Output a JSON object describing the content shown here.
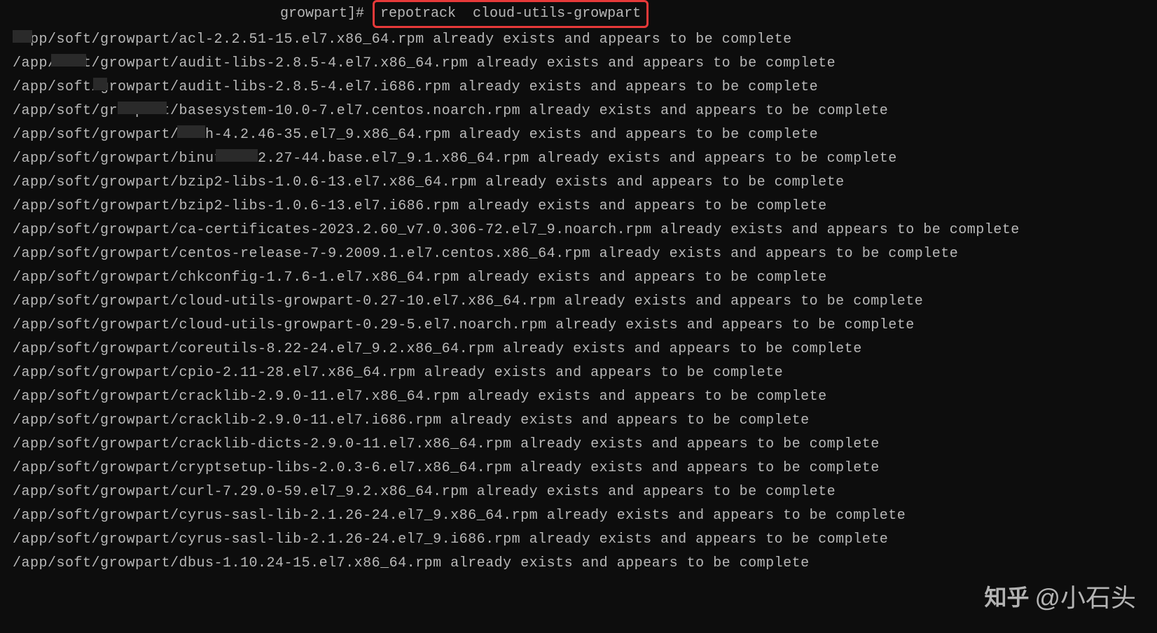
{
  "prompt": {
    "path_suffix": " growpart]# ",
    "command": "repotrack  cloud-utils-growpart"
  },
  "output_lines": [
    "/app/soft/growpart/acl-2.2.51-15.el7.x86_64.rpm already exists and appears to be complete",
    "/app/soft/growpart/audit-libs-2.8.5-4.el7.x86_64.rpm already exists and appears to be complete",
    "/app/soft/growpart/audit-libs-2.8.5-4.el7.i686.rpm already exists and appears to be complete",
    "/app/soft/growpart/basesystem-10.0-7.el7.centos.noarch.rpm already exists and appears to be complete",
    "/app/soft/growpart/bash-4.2.46-35.el7_9.x86_64.rpm already exists and appears to be complete",
    "/app/soft/growpart/binutils-2.27-44.base.el7_9.1.x86_64.rpm already exists and appears to be complete",
    "/app/soft/growpart/bzip2-libs-1.0.6-13.el7.x86_64.rpm already exists and appears to be complete",
    "/app/soft/growpart/bzip2-libs-1.0.6-13.el7.i686.rpm already exists and appears to be complete",
    "/app/soft/growpart/ca-certificates-2023.2.60_v7.0.306-72.el7_9.noarch.rpm already exists and appears to be complete",
    "/app/soft/growpart/centos-release-7-9.2009.1.el7.centos.x86_64.rpm already exists and appears to be complete",
    "/app/soft/growpart/chkconfig-1.7.6-1.el7.x86_64.rpm already exists and appears to be complete",
    "/app/soft/growpart/cloud-utils-growpart-0.27-10.el7.x86_64.rpm already exists and appears to be complete",
    "/app/soft/growpart/cloud-utils-growpart-0.29-5.el7.noarch.rpm already exists and appears to be complete",
    "/app/soft/growpart/coreutils-8.22-24.el7_9.2.x86_64.rpm already exists and appears to be complete",
    "/app/soft/growpart/cpio-2.11-28.el7.x86_64.rpm already exists and appears to be complete",
    "/app/soft/growpart/cracklib-2.9.0-11.el7.x86_64.rpm already exists and appears to be complete",
    "/app/soft/growpart/cracklib-2.9.0-11.el7.i686.rpm already exists and appears to be complete",
    "/app/soft/growpart/cracklib-dicts-2.9.0-11.el7.x86_64.rpm already exists and appears to be complete",
    "/app/soft/growpart/cryptsetup-libs-2.0.3-6.el7.x86_64.rpm already exists and appears to be complete",
    "/app/soft/growpart/curl-7.29.0-59.el7_9.2.x86_64.rpm already exists and appears to be complete",
    "/app/soft/growpart/cyrus-sasl-lib-2.1.26-24.el7_9.x86_64.rpm already exists and appears to be complete",
    "/app/soft/growpart/cyrus-sasl-lib-2.1.26-24.el7_9.i686.rpm already exists and appears to be complete",
    "/app/soft/growpart/dbus-1.10.24-15.el7.x86_64.rpm already exists and appears to be complete"
  ],
  "watermark": {
    "logo": "知乎",
    "author": "@小石头"
  }
}
